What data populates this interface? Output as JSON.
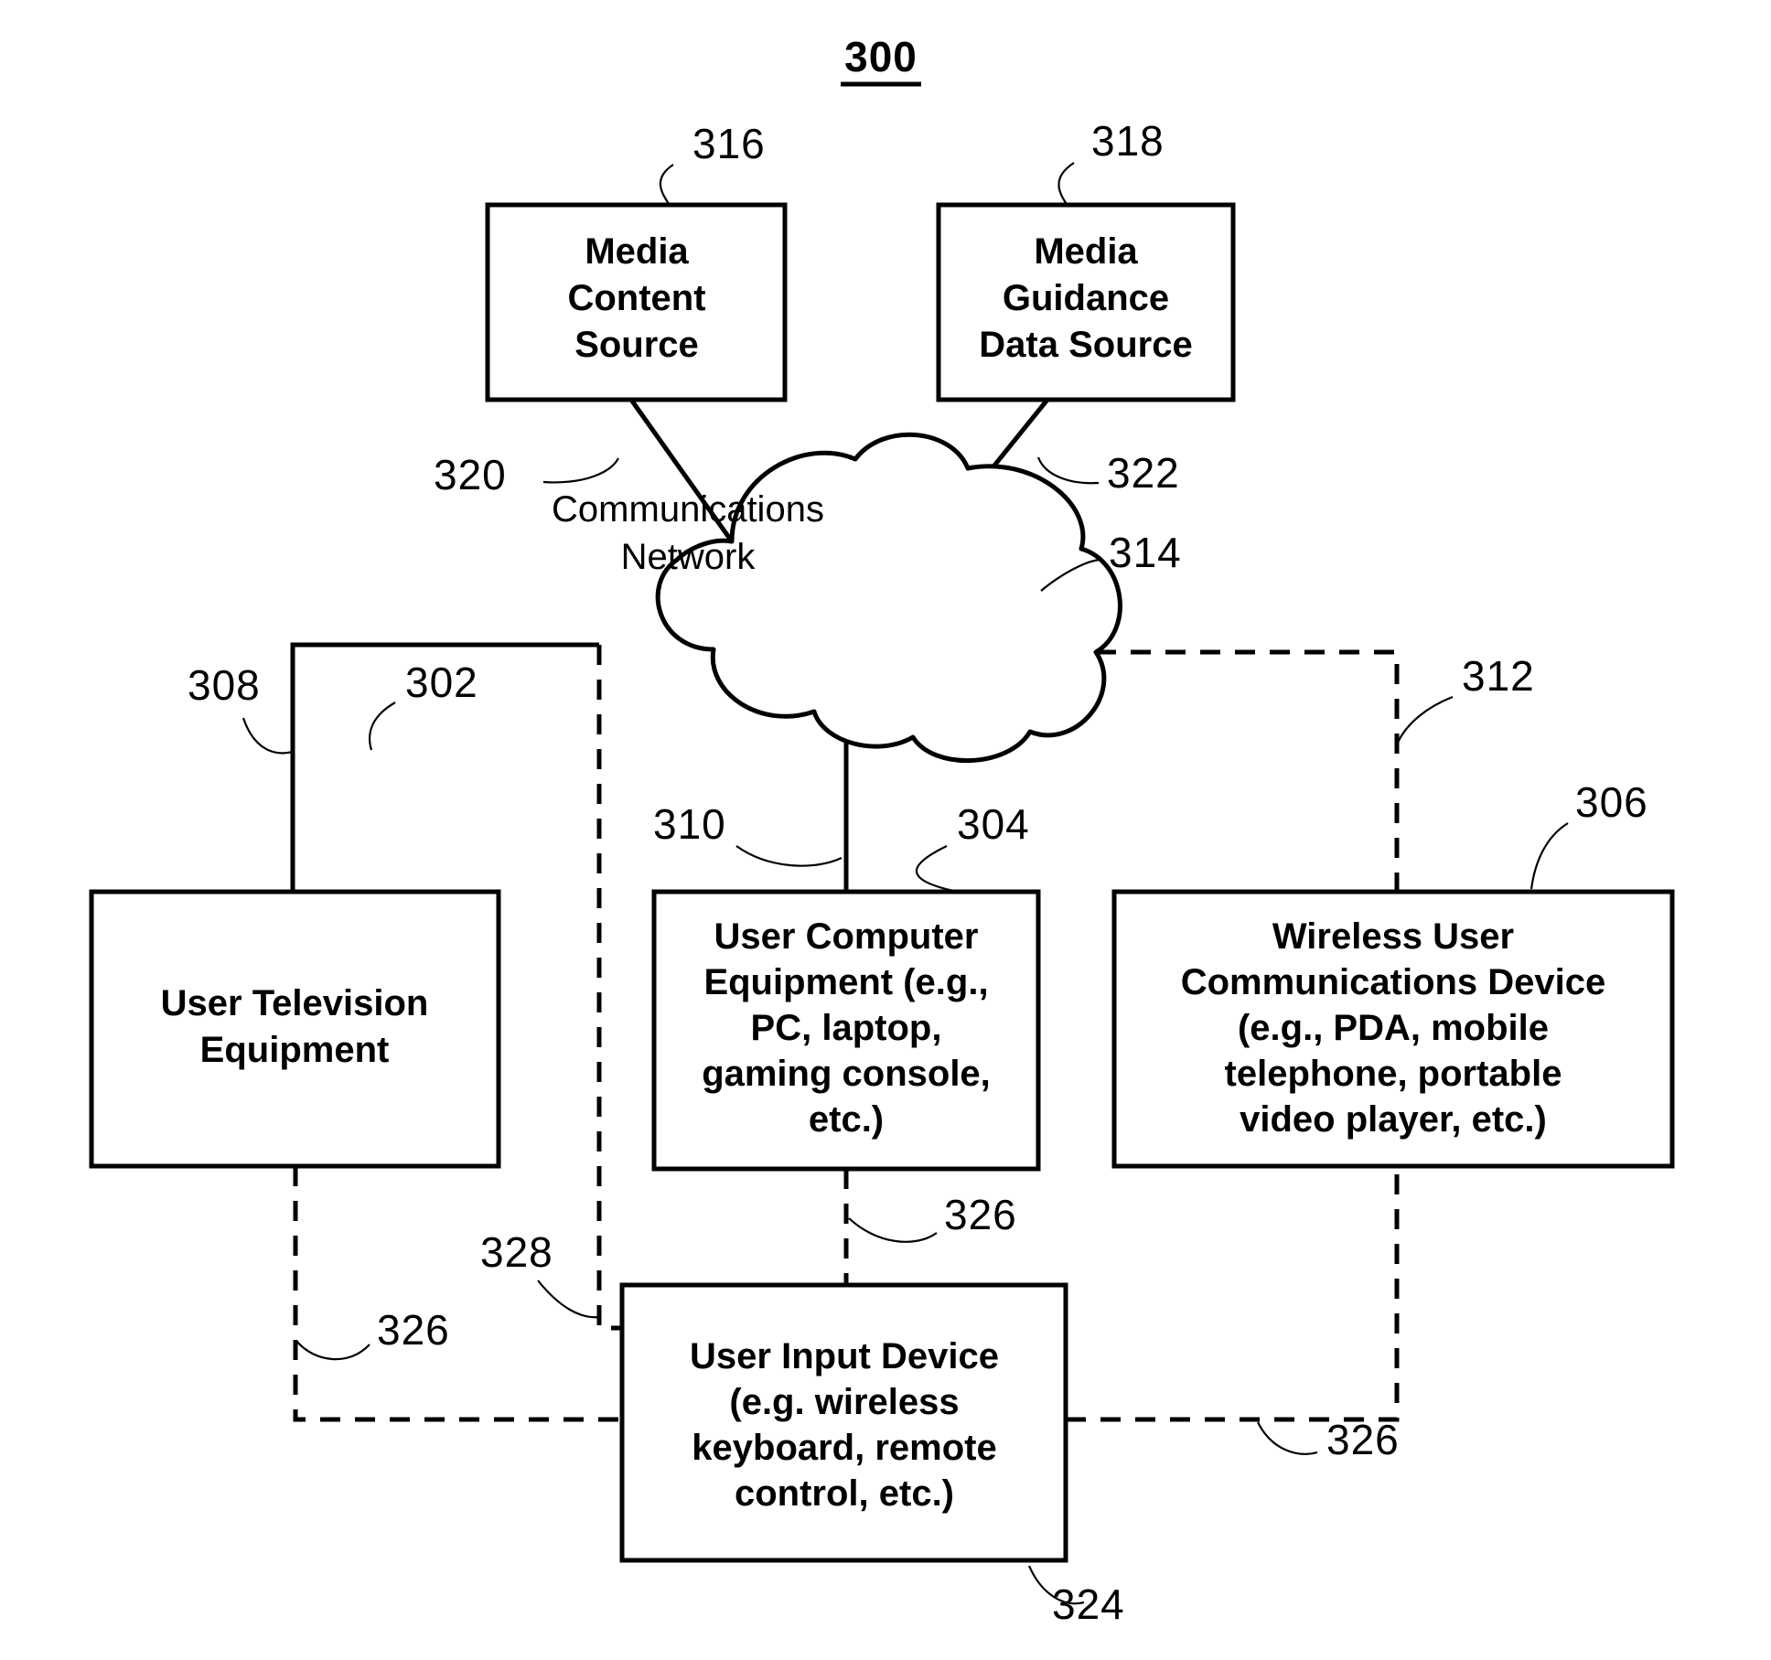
{
  "figure": {
    "title": "300"
  },
  "nodes": {
    "media_content_source": {
      "lines": [
        "Media",
        "Content",
        "Source"
      ],
      "ref": "316"
    },
    "media_guidance_data_source": {
      "lines": [
        "Media",
        "Guidance",
        "Data Source"
      ],
      "ref": "318"
    },
    "communications_network": {
      "lines": [
        "Communications",
        "Network"
      ],
      "ref": "314"
    },
    "user_television_equipment": {
      "lines": [
        "User Television",
        "Equipment"
      ],
      "ref": "302"
    },
    "user_computer_equipment": {
      "lines": [
        "User Computer",
        "Equipment (e.g.,",
        "PC, laptop,",
        "gaming console,",
        "etc.)"
      ],
      "ref": "304"
    },
    "wireless_user_communications_device": {
      "lines": [
        "Wireless User",
        "Communications Device",
        "(e.g., PDA, mobile",
        "telephone, portable",
        "video player, etc.)"
      ],
      "ref": "306"
    },
    "user_input_device": {
      "lines": [
        "User Input Device",
        "(e.g. wireless",
        "keyboard, remote",
        "control, etc.)"
      ],
      "ref": "324"
    }
  },
  "connections": {
    "content_source_to_network": "320",
    "guidance_source_to_network": "322",
    "network_to_television": "308",
    "network_to_computer": "310",
    "network_to_wireless": "312",
    "television_to_input": "326",
    "computer_to_input": "326",
    "wireless_to_input": "326",
    "network_to_input": "328"
  },
  "colors": {
    "stroke": "#000000",
    "background": "#ffffff",
    "text": "#000000"
  }
}
